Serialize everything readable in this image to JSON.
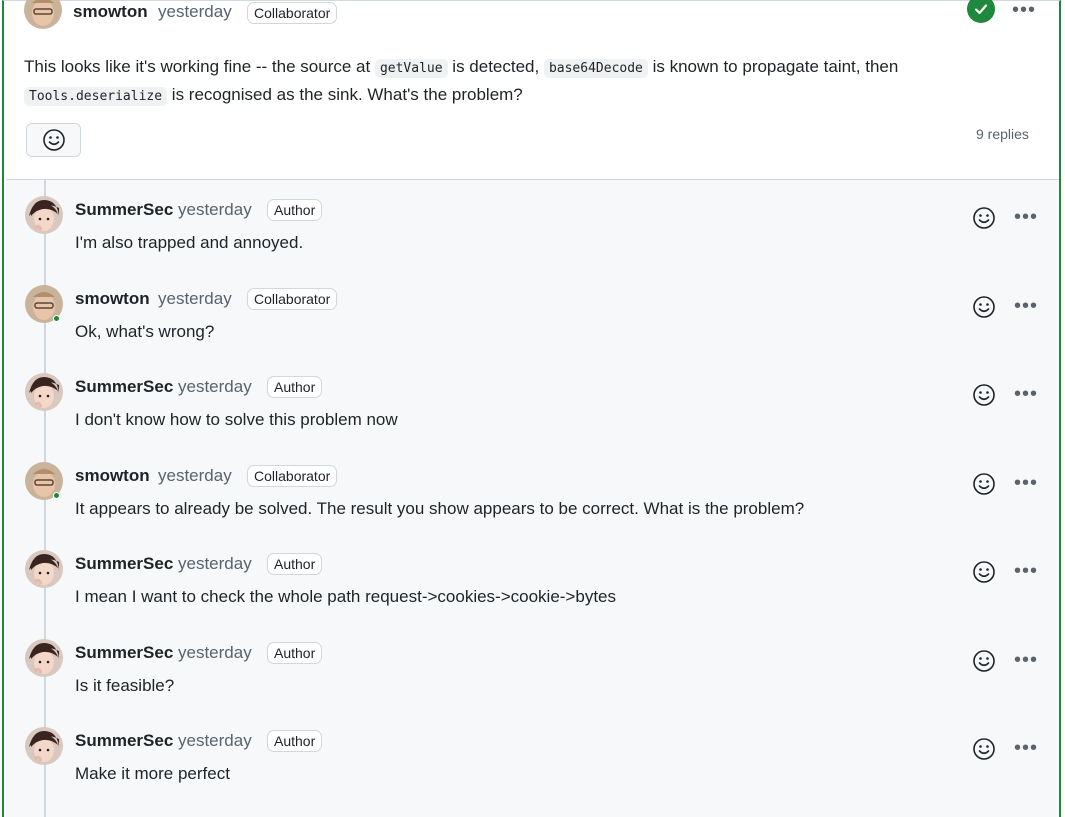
{
  "top_comment": {
    "author": "smowton",
    "time": "yesterday",
    "badge": "Collaborator",
    "text_parts": {
      "p1": "This looks like it's working fine -- the source at ",
      "code1": "getValue",
      "p2": " is detected, ",
      "code2": "base64Decode",
      "p3": " is known to propagate taint, then",
      "code3": "Tools.deserialize",
      "p4": " is recognised as the sink. What's the problem?"
    },
    "replies_count": "9 replies"
  },
  "replies": [
    {
      "author": "SummerSec",
      "time": "yesterday",
      "badge": "Author",
      "text": "I'm also trapped and annoyed."
    },
    {
      "author": "smowton",
      "time": "yesterday",
      "badge": "Collaborator",
      "text": "Ok, what's wrong?"
    },
    {
      "author": "SummerSec",
      "time": "yesterday",
      "badge": "Author",
      "text": "I don't know how to solve this problem now"
    },
    {
      "author": "smowton",
      "time": "yesterday",
      "badge": "Collaborator",
      "text": "It appears to already be solved. The result you show appears to be correct. What is the problem?"
    },
    {
      "author": "SummerSec",
      "time": "yesterday",
      "badge": "Author",
      "text": "I mean I want to check the whole path request->cookies->cookie->bytes"
    },
    {
      "author": "SummerSec",
      "time": "yesterday",
      "badge": "Author",
      "text": "Is it feasible?"
    },
    {
      "author": "SummerSec",
      "time": "yesterday",
      "badge": "Author",
      "text": "Make it more perfect"
    }
  ],
  "icons": {
    "answered": "check-circle-icon",
    "reaction": "smiley-icon",
    "more": "kebab-horizontal-icon"
  },
  "colors": {
    "accent_green": "#1f883d",
    "border": "#d0d7de",
    "muted": "#59636e",
    "reply_bg": "#f6f8fa"
  }
}
